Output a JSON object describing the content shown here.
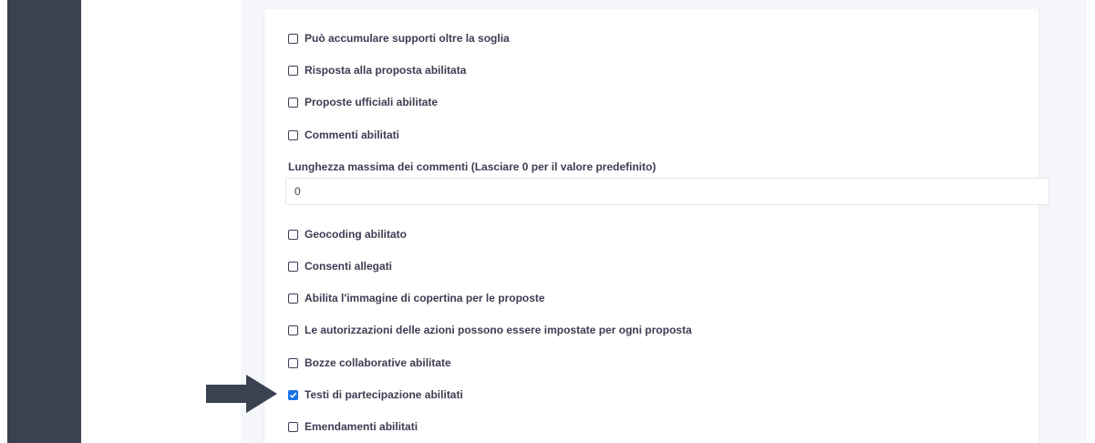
{
  "settings": {
    "options": [
      {
        "label": "Può accumulare supporti oltre la soglia",
        "checked": false
      },
      {
        "label": "Risposta alla proposta abilitata",
        "checked": false
      },
      {
        "label": "Proposte ufficiali abilitate",
        "checked": false
      },
      {
        "label": "Commenti abilitati",
        "checked": false
      }
    ],
    "comment_length": {
      "label": "Lunghezza massima dei commenti (Lasciare 0 per il valore predefinito)",
      "value": "0"
    },
    "options2": [
      {
        "label": "Geocoding abilitato",
        "checked": false
      },
      {
        "label": "Consenti allegati",
        "checked": false
      },
      {
        "label": "Abilita l'immagine di copertina per le proposte",
        "checked": false
      },
      {
        "label": "Le autorizzazioni delle azioni possono essere impostate per ogni proposta",
        "checked": false
      },
      {
        "label": "Bozze collaborative abilitate",
        "checked": false
      },
      {
        "label": "Testi di partecipazione abilitati",
        "checked": true
      },
      {
        "label": "Emendamenti abilitati",
        "checked": false
      }
    ]
  },
  "colors": {
    "sidebar": "#3a4150",
    "checkbox_checked": "#1a73e8",
    "arrow": "#3a4150"
  },
  "annotation": {
    "icon": "arrow-right-icon"
  }
}
